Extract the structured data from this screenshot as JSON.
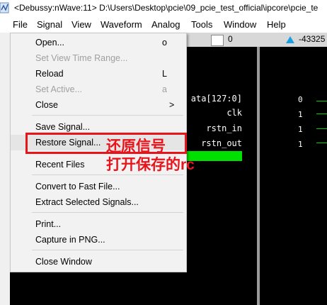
{
  "titlebar": {
    "title": "<Debussy:nWave:11> D:\\Users\\Desktop\\pcie\\09_pcie_test_official\\ipcore\\pcie_te",
    "icon": "nwave-app-icon"
  },
  "menubar": [
    "File",
    "Signal",
    "View",
    "Waveform",
    "Analog",
    "Tools",
    "Window",
    "Help"
  ],
  "toolbar": {
    "cursor_value": "0",
    "marker_value": "-43325"
  },
  "signals": [
    {
      "name": "ata[127:0]",
      "value": "0"
    },
    {
      "name": "clk",
      "value": "1"
    },
    {
      "name": "rstn_in",
      "value": "1"
    },
    {
      "name": "rstn_out",
      "value": "1"
    }
  ],
  "file_menu": {
    "items": [
      {
        "label": "Open...",
        "shortcut": "o",
        "enabled": true
      },
      {
        "label": "Set View Time Range...",
        "shortcut": "",
        "enabled": false
      },
      {
        "label": "Reload",
        "shortcut": "L",
        "enabled": true
      },
      {
        "label": "Set Active...",
        "shortcut": "a",
        "enabled": false
      },
      {
        "label": "Close",
        "shortcut": ">",
        "enabled": true
      },
      {
        "label": "Save Signal...",
        "shortcut": "",
        "enabled": true
      },
      {
        "label": "Restore Signal...",
        "shortcut": "",
        "enabled": true
      },
      {
        "label": "Recent Files",
        "shortcut": "",
        "enabled": true
      },
      {
        "label": "Convert to Fast File...",
        "shortcut": "",
        "enabled": true
      },
      {
        "label": "Extract Selected Signals...",
        "shortcut": "",
        "enabled": true
      },
      {
        "label": "Print...",
        "shortcut": "",
        "enabled": true
      },
      {
        "label": "Capture in PNG...",
        "shortcut": "",
        "enabled": true
      },
      {
        "label": "Close Window",
        "shortcut": "",
        "enabled": true
      }
    ]
  },
  "annotation": {
    "text": "还原信号\n打开保存的rc",
    "color": "#e8141c"
  }
}
